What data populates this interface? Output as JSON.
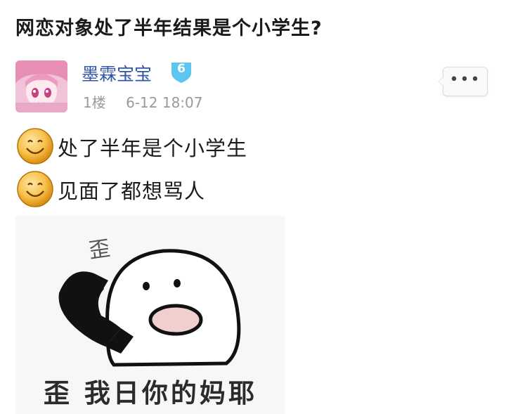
{
  "post": {
    "title": "网恋对象处了半年结果是个小学生?"
  },
  "author": {
    "name": "墨霖宝宝",
    "level": "6",
    "floor": "1楼",
    "time": "6-12 18:07",
    "avatar_icon": "anime-avatar"
  },
  "more_button": {
    "label": "•••"
  },
  "content": {
    "lines": [
      {
        "emoji": "smile-emoji",
        "text": "处了半年是个小学生"
      },
      {
        "emoji": "smile-emoji",
        "text": "见面了都想骂人"
      }
    ],
    "meme": {
      "speech_text": "歪",
      "caption": "歪 我日你的妈耶"
    }
  },
  "colors": {
    "username": "#2f55a6",
    "badge": "#5bc6ef",
    "meta": "#9a9a9a"
  }
}
